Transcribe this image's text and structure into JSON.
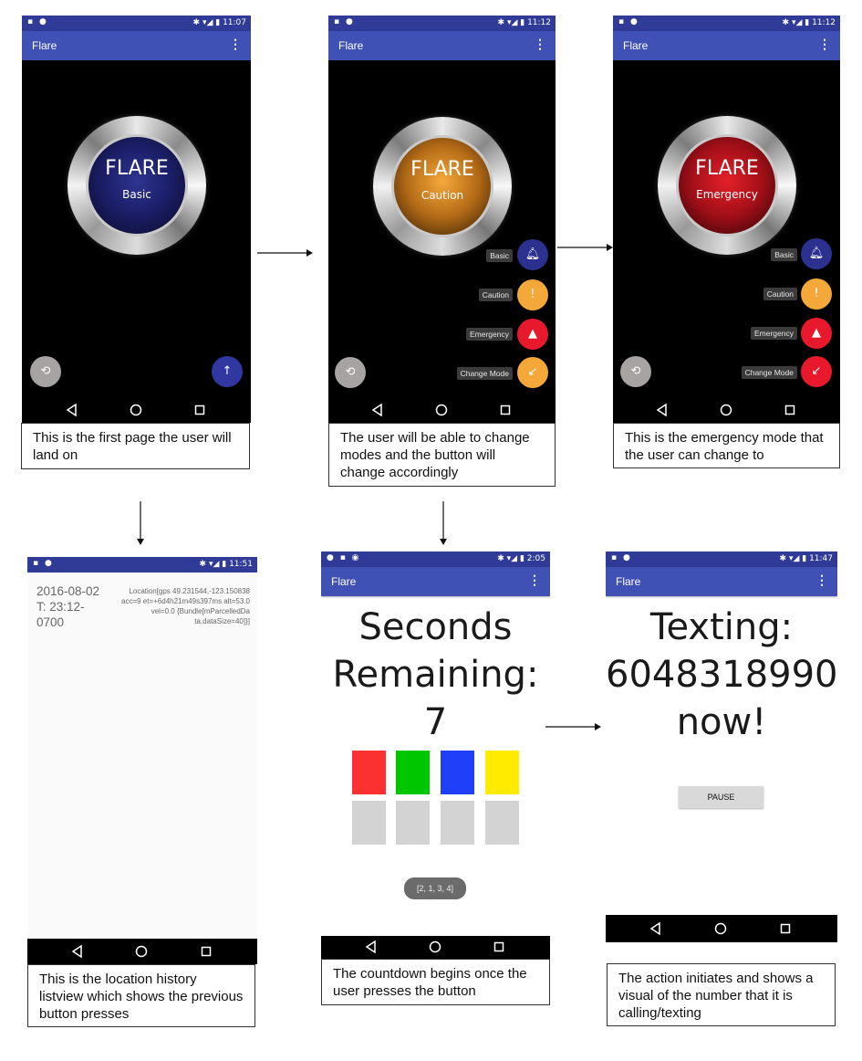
{
  "app_title": "Flare",
  "menu_icon": "⋮",
  "status": {
    "phone1_time": "11:07",
    "phone2_time": "11:12",
    "phone3_time": "11:12",
    "phone4_time": "11:51",
    "phone5_time": "2:05",
    "phone6_time": "11:47"
  },
  "flare_button": {
    "title": "FLARE"
  },
  "modes": {
    "basic": "Basic",
    "caution": "Caution",
    "emergency": "Emergency",
    "change_mode": "Change Mode"
  },
  "colors": {
    "basic": "#2c3190",
    "caution": "#f4a83a",
    "emergency": "#e8192c",
    "history_fab": "#9e9e9e",
    "primary": "#3f51b5"
  },
  "captions": {
    "phone1": "This is the first page the user will land on",
    "phone2": "The user will be able to change modes and the button will change accordingly",
    "phone3": "This is the emergency mode that the user can change to",
    "phone4": "This is the location history listview which shows the previous button presses",
    "phone5": "The countdown begins once the user presses the button",
    "phone6": "The action initiates and shows a visual of the number that it is calling/texting"
  },
  "history": {
    "date": "2016-08-02 T: 23:12-0700",
    "location": "Location[gps 49.231544,-123.150838 acc=9 et=+6d4h21m49s397ms alt=53.0 vel=0.0 {Bundle[mParcelledDa ta.dataSize=40]}]"
  },
  "countdown": {
    "line1": "Seconds",
    "line2": "Remaining:",
    "value": "7",
    "square_colors": [
      "#fb3131",
      "#00c600",
      "#1f3ff9",
      "#ffeb00"
    ],
    "toast": "[2, 1, 3, 4]"
  },
  "texting": {
    "line1": "Texting:",
    "number": "6048318990",
    "line3": "now!",
    "pause_label": "PAUSE"
  }
}
